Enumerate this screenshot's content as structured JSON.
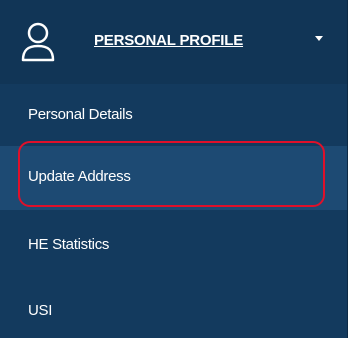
{
  "header": {
    "title": "PERSONAL PROFILE",
    "icon": "user-icon",
    "caret_icon": "caret-down-icon"
  },
  "menu": {
    "items": [
      {
        "label": "Personal Details",
        "selected": false
      },
      {
        "label": "Update Address",
        "selected": true
      },
      {
        "label": "HE Statistics",
        "selected": false
      },
      {
        "label": "USI",
        "selected": false
      }
    ]
  },
  "colors": {
    "sidebar_bg": "#133a5e",
    "selected_bg": "#1d4a73",
    "highlight": "#e0102a",
    "text": "#ffffff"
  }
}
